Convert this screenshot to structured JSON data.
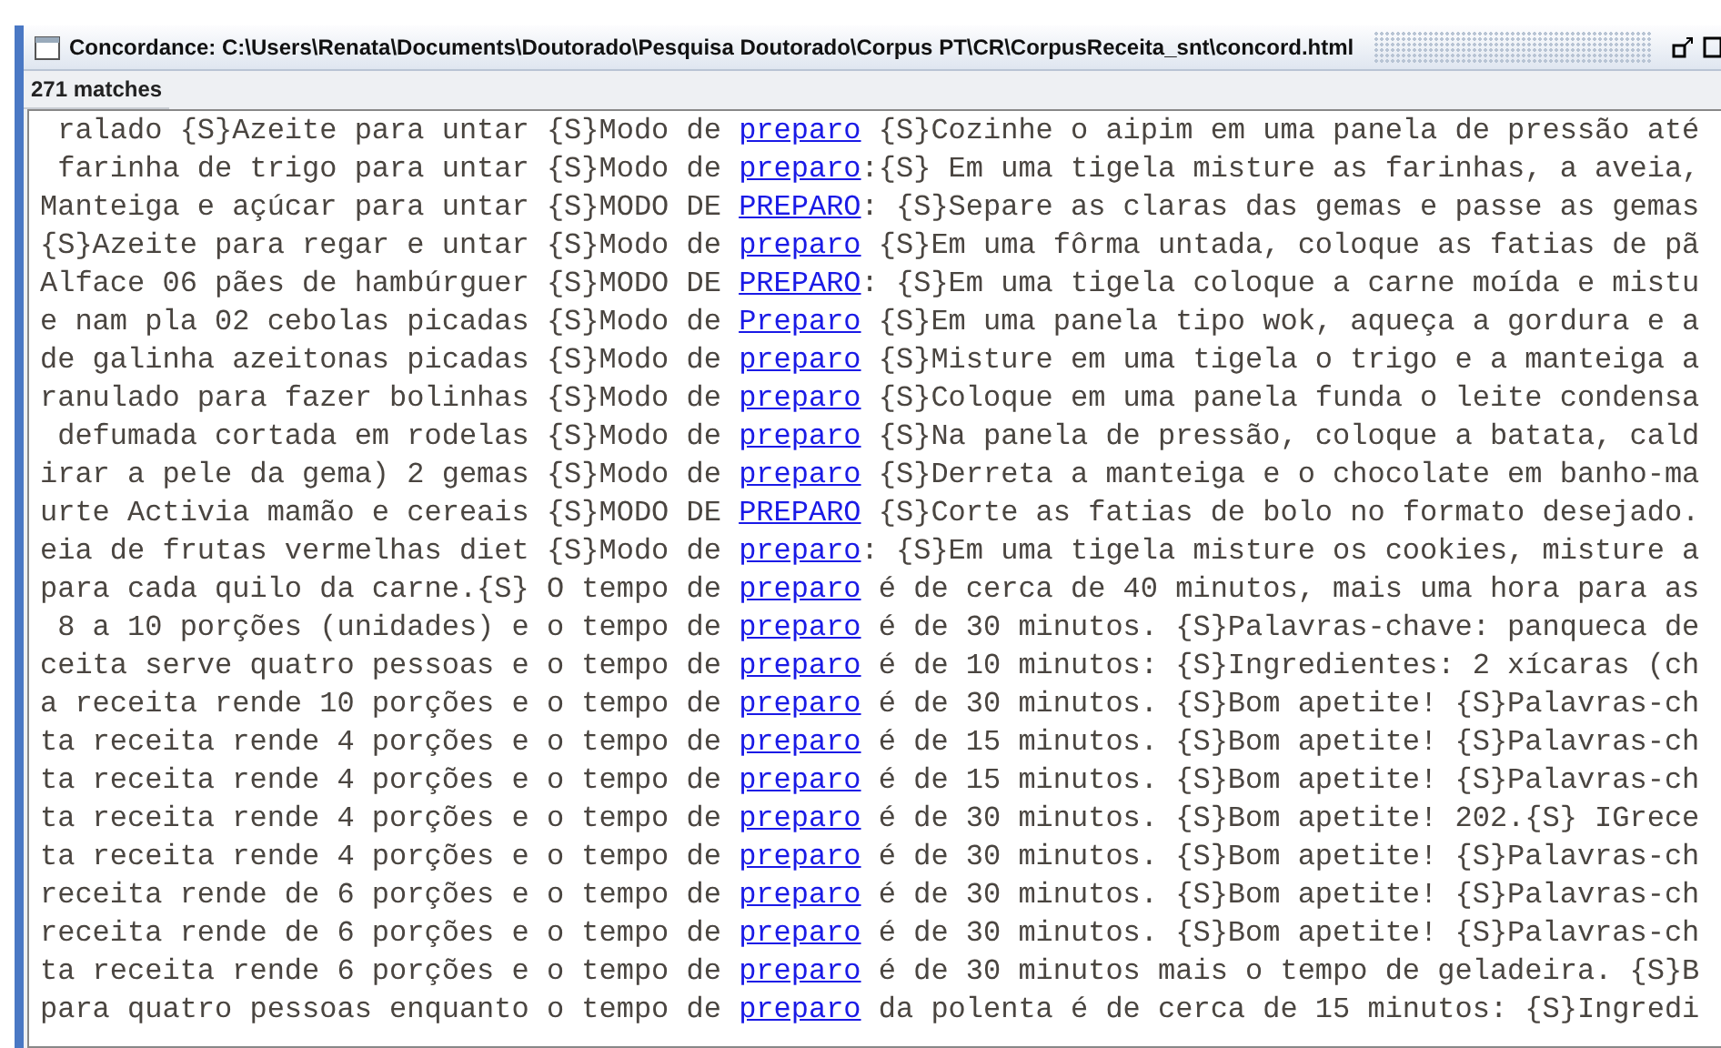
{
  "window": {
    "title": "Concordance: C:\\Users\\Renata\\Documents\\Doutorado\\Pesquisa Doutorado\\Corpus PT\\CR\\CorpusReceita_snt\\concord.html"
  },
  "match_count": "271 matches",
  "lines": [
    {
      "left": " ralado {S}Azeite para untar {S}Modo de ",
      "keyword": "preparo",
      "right": " {S}Cozinhe o aipim em uma panela de pressão até"
    },
    {
      "left": " farinha de trigo para untar {S}Modo de ",
      "keyword": "preparo",
      "right": ":{S} Em uma tigela misture as farinhas, a aveia,"
    },
    {
      "left": "Manteiga e açúcar para untar {S}MODO DE ",
      "keyword": "PREPARO",
      "right": ": {S}Separe as claras das gemas e passe as gemas"
    },
    {
      "left": "{S}Azeite para regar e untar {S}Modo de ",
      "keyword": "preparo",
      "right": " {S}Em uma fôrma untada, coloque as fatias de pã"
    },
    {
      "left": "Alface 06 pães de hambúrguer {S}MODO DE ",
      "keyword": "PREPARO",
      "right": ": {S}Em uma tigela coloque a carne moída e mistu"
    },
    {
      "left": "e nam pla 02 cebolas picadas {S}Modo de ",
      "keyword": "Preparo",
      "right": " {S}Em uma panela tipo wok, aqueça a gordura e a"
    },
    {
      "left": "de galinha azeitonas picadas {S}Modo de ",
      "keyword": "preparo",
      "right": " {S}Misture em uma tigela o trigo e a manteiga a"
    },
    {
      "left": "ranulado para fazer bolinhas {S}Modo de ",
      "keyword": "preparo",
      "right": " {S}Coloque em uma panela funda o leite condensa"
    },
    {
      "left": " defumada cortada em rodelas {S}Modo de ",
      "keyword": "preparo",
      "right": " {S}Na panela de pressão, coloque a batata, cald"
    },
    {
      "left": "irar a pele da gema) 2 gemas {S}Modo de ",
      "keyword": "preparo",
      "right": " {S}Derreta a manteiga e o chocolate em banho-ma"
    },
    {
      "left": "urte Activia mamão e cereais {S}MODO DE ",
      "keyword": "PREPARO",
      "right": " {S}Corte as fatias de bolo no formato desejado."
    },
    {
      "left": "eia de frutas vermelhas diet {S}Modo de ",
      "keyword": "preparo",
      "right": ": {S}Em uma tigela misture os cookies, misture a"
    },
    {
      "left": "para cada quilo da carne.{S} O tempo de ",
      "keyword": "preparo",
      "right": " é de cerca de 40 minutos, mais uma hora para as"
    },
    {
      "left": " 8 a 10 porções (unidades) e o tempo de ",
      "keyword": "preparo",
      "right": " é de 30 minutos. {S}Palavras-chave: panqueca de"
    },
    {
      "left": "ceita serve quatro pessoas e o tempo de ",
      "keyword": "preparo",
      "right": " é de 10 minutos: {S}Ingredientes: 2 xícaras (ch"
    },
    {
      "left": "a receita rende 10 porções e o tempo de ",
      "keyword": "preparo",
      "right": " é de 30 minutos. {S}Bom apetite! {S}Palavras-ch"
    },
    {
      "left": "ta receita rende 4 porções e o tempo de ",
      "keyword": "preparo",
      "right": " é de 15 minutos. {S}Bom apetite! {S}Palavras-ch"
    },
    {
      "left": "ta receita rende 4 porções e o tempo de ",
      "keyword": "preparo",
      "right": " é de 15 minutos. {S}Bom apetite! {S}Palavras-ch"
    },
    {
      "left": "ta receita rende 4 porções e o tempo de ",
      "keyword": "preparo",
      "right": " é de 30 minutos. {S}Bom apetite! 202.{S} IGrece"
    },
    {
      "left": "ta receita rende 4 porções e o tempo de ",
      "keyword": "preparo",
      "right": " é de 30 minutos. {S}Bom apetite! {S}Palavras-ch"
    },
    {
      "left": "receita rende de 6 porções e o tempo de ",
      "keyword": "preparo",
      "right": " é de 30 minutos. {S}Bom apetite! {S}Palavras-ch"
    },
    {
      "left": "receita rende de 6 porções e o tempo de ",
      "keyword": "preparo",
      "right": " é de 30 minutos. {S}Bom apetite! {S}Palavras-ch"
    },
    {
      "left": "ta receita rende 6 porções e o tempo de ",
      "keyword": "preparo",
      "right": " é de 30 minutos mais o tempo de geladeira. {S}B"
    },
    {
      "left": "para quatro pessoas enquanto o tempo de ",
      "keyword": "preparo",
      "right": " da polenta é de cerca de 15 minutos: {S}Ingredi"
    }
  ]
}
